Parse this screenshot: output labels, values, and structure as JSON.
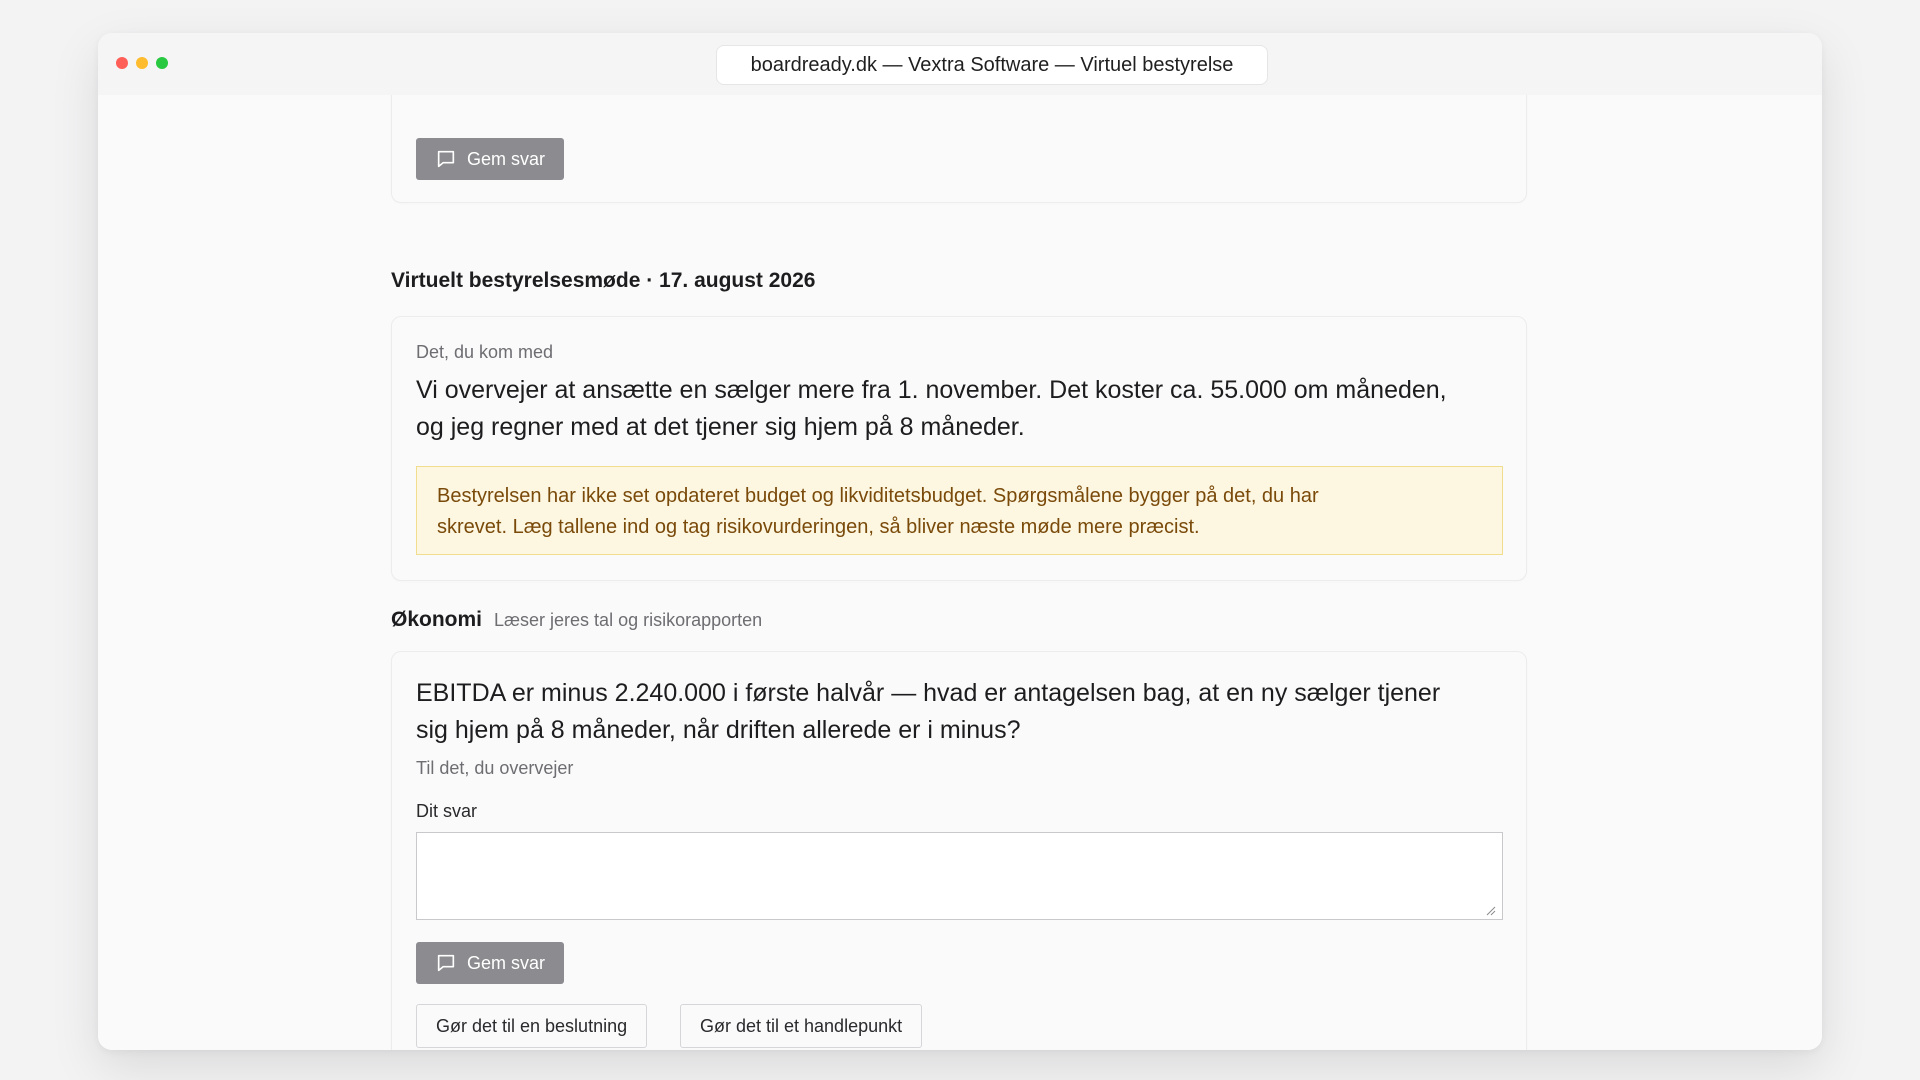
{
  "window": {
    "url_title": "boardready.dk — Vextra Software — Virtuel bestyrelse"
  },
  "previous_card": {
    "save_label": "Gem svar"
  },
  "meeting": {
    "heading": "Virtuelt bestyrelsesmøde · 17. august 2026",
    "input_label": "Det, du kom med",
    "input_text_line1": "Vi overvejer at ansætte en sælger mere fra 1. november. Det koster ca. 55.000 om måneden,",
    "input_text_line2": "og jeg regner med at det tjener sig hjem på 8 måneder.",
    "warning_line1": "Bestyrelsen har ikke set opdateret budget og likviditetsbudget. Spørgsmålene bygger på det, du har",
    "warning_line2": "skrevet. Læg tallene ind og tag risikovurderingen, så bliver næste møde mere præcist."
  },
  "economy": {
    "title": "Økonomi",
    "subtitle": "Læser jeres tal og risikorapporten",
    "question_line1": "EBITDA er minus 2.240.000 i første halvår — hvad er antagelsen bag, at en ny sælger tjener",
    "question_line2": "sig hjem på 8 måneder, når driften allerede er i minus?",
    "context": "Til det, du overvejer",
    "answer_label": "Dit svar",
    "answer_value": "",
    "answer_placeholder": "",
    "save_label": "Gem svar",
    "decision_label": "Gør det til en beslutning",
    "action_label": "Gør det til et handlepunkt"
  },
  "colors": {
    "warning_bg": "#fdf7e1",
    "warning_border": "#f1dd8e",
    "warning_text": "#7a4a0a",
    "button_bg": "#8c8c90"
  },
  "icons": {
    "save": "speech-bubble-icon"
  }
}
